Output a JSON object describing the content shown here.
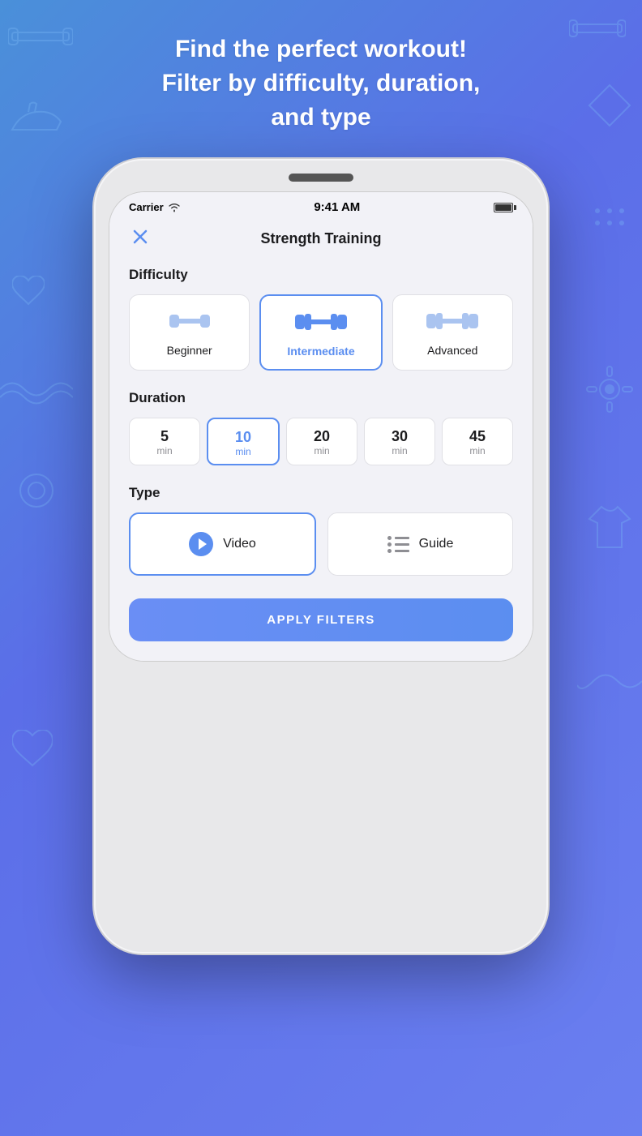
{
  "background": {
    "gradient_start": "#4a90d9",
    "gradient_end": "#6a7ff0"
  },
  "header": {
    "title_line1": "Find the perfect workout!",
    "title_line2": "Filter by difficulty, duration,",
    "title_line3": "and type"
  },
  "status_bar": {
    "carrier": "Carrier",
    "time": "9:41 AM"
  },
  "nav": {
    "title": "Strength Training",
    "close_icon": "×"
  },
  "difficulty": {
    "section_label": "Difficulty",
    "options": [
      {
        "id": "beginner",
        "label": "Beginner",
        "selected": false,
        "bars": 1
      },
      {
        "id": "intermediate",
        "label": "Intermediate",
        "selected": true,
        "bars": 2
      },
      {
        "id": "advanced",
        "label": "Advanced",
        "selected": false,
        "bars": 3
      }
    ]
  },
  "duration": {
    "section_label": "Duration",
    "options": [
      {
        "id": "5",
        "value": "5",
        "unit": "min",
        "selected": false
      },
      {
        "id": "10",
        "value": "10",
        "unit": "min",
        "selected": true
      },
      {
        "id": "20",
        "value": "20",
        "unit": "min",
        "selected": false
      },
      {
        "id": "30",
        "value": "30",
        "unit": "min",
        "selected": false
      },
      {
        "id": "45",
        "value": "45",
        "unit": "min",
        "selected": false
      }
    ]
  },
  "type": {
    "section_label": "Type",
    "options": [
      {
        "id": "video",
        "label": "Video",
        "selected": true
      },
      {
        "id": "guide",
        "label": "Guide",
        "selected": false
      }
    ]
  },
  "apply_button": {
    "label": "APPLY FILTERS"
  }
}
